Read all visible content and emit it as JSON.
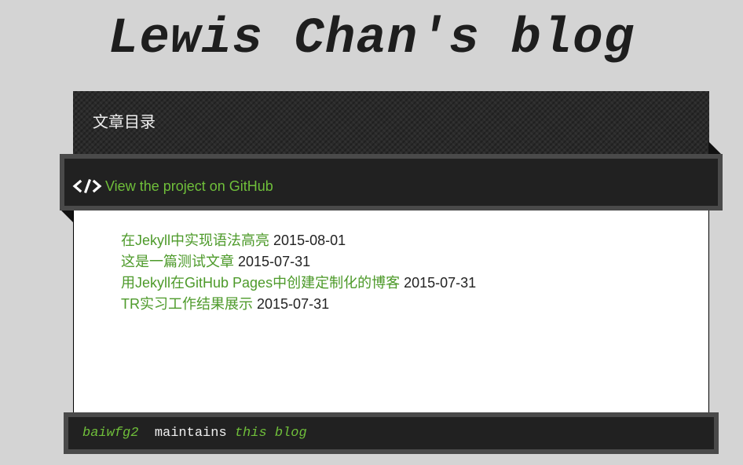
{
  "site": {
    "title": "Lewis Chan's blog"
  },
  "header": {
    "toc_title": "文章目录"
  },
  "banner": {
    "github_link_label": "View the project on GitHub",
    "icon": "code-icon"
  },
  "posts": [
    {
      "title": "在Jekyll中实现语法高亮",
      "date": "2015-08-01"
    },
    {
      "title": "这是一篇测试文章",
      "date": "2015-07-31"
    },
    {
      "title": "用Jekyll在GitHub Pages中创建定制化的博客",
      "date": "2015-07-31"
    },
    {
      "title": "TR实习工作结果展示",
      "date": "2015-07-31"
    }
  ],
  "footer": {
    "author": "baiwfg2",
    "middle": "  maintains ",
    "blog_link": "this blog"
  },
  "colors": {
    "background": "#d4d4d4",
    "link_green": "#4d9a2a",
    "banner_green": "#6fbf3a",
    "dark_panel": "#212121"
  }
}
